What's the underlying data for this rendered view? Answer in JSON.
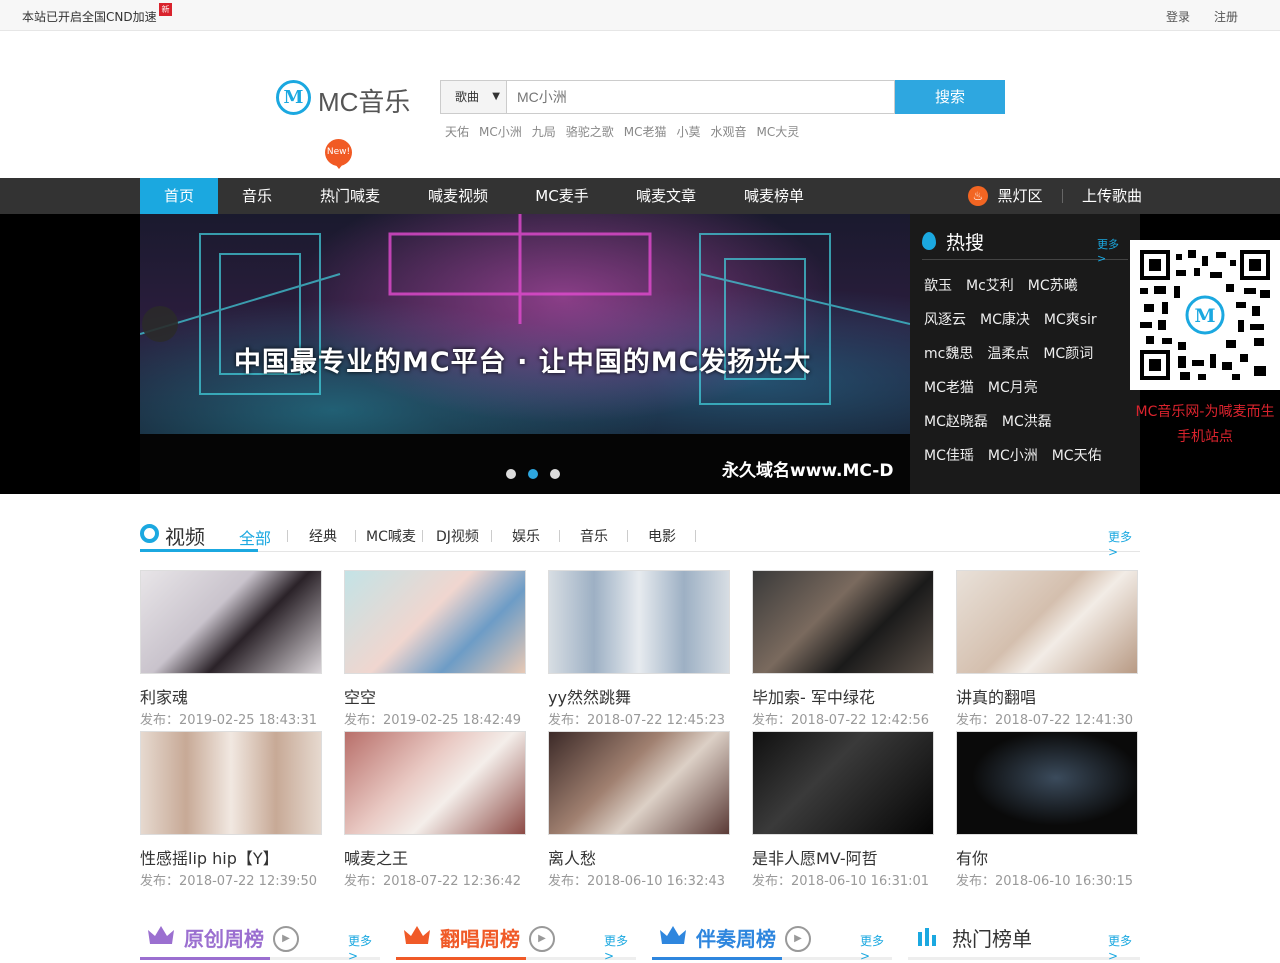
{
  "topbar": {
    "notice": "本站已开启全国CND加速",
    "new_tag": "新",
    "login": "登录",
    "register": "注册"
  },
  "logo": {
    "letter": "M",
    "text": "MC音乐"
  },
  "search": {
    "type": "歌曲",
    "placeholder": "MC小洲",
    "button": "搜索",
    "hotwords": [
      "天佑",
      "MC小洲",
      "九局",
      "骆驼之歌",
      "MC老猫",
      "小莫",
      "水观音",
      "MC大灵"
    ]
  },
  "new_badge": "New!",
  "nav": {
    "items": [
      "首页",
      "音乐",
      "热门喊麦",
      "喊麦视频",
      "MC麦手",
      "喊麦文章",
      "喊麦榜单"
    ],
    "blacklight": "黑灯区",
    "upload": "上传歌曲"
  },
  "banner": {
    "slogan": "中国最专业的MC平台 · 让中国的MC发扬光大",
    "domain": "永久域名www.MC-D"
  },
  "hotsearch": {
    "title": "热搜",
    "more": "更多>",
    "tags": [
      [
        "歆玉",
        "Mc艾利",
        "MC苏曦"
      ],
      [
        "风逐云",
        "MC康决",
        "MC爽sir"
      ],
      [
        "mc魏思",
        "温柔点",
        "MC颜词"
      ],
      [
        "MC老猫",
        "MC月亮"
      ],
      [
        "MC赵晓磊",
        "MC洪磊"
      ],
      [
        "MC佳瑶",
        "MC小洲",
        "MC天佑"
      ]
    ]
  },
  "qr": {
    "caption_line1": "MC音乐网-为喊麦而生",
    "caption_line2": "手机站点"
  },
  "video": {
    "title": "视频",
    "more": "更多>",
    "categories": [
      "全部",
      "经典",
      "MC喊麦",
      "DJ视频",
      "娱乐",
      "音乐",
      "电影"
    ],
    "items": [
      {
        "name": "利家魂",
        "date": "发布：2019-02-25 18:43:31"
      },
      {
        "name": "空空",
        "date": "发布：2019-02-25 18:42:49"
      },
      {
        "name": "yy然然跳舞",
        "date": "发布：2018-07-22 12:45:23"
      },
      {
        "name": "毕加索- 军中绿花",
        "date": "发布：2018-07-22 12:42:56"
      },
      {
        "name": "讲真的翻唱",
        "date": "发布：2018-07-22 12:41:30"
      },
      {
        "name": "性感摇lip hip【Y】",
        "date": "发布：2018-07-22 12:39:50"
      },
      {
        "name": "喊麦之王",
        "date": "发布：2018-07-22 12:36:42"
      },
      {
        "name": "离人愁",
        "date": "发布：2018-06-10 16:32:43"
      },
      {
        "name": "是非人愿MV-阿哲",
        "date": "发布：2018-06-10 16:31:01"
      },
      {
        "name": "有你",
        "date": "发布：2018-06-10 16:30:15"
      }
    ]
  },
  "charts": [
    {
      "title": "原创周榜",
      "more": "更多>",
      "color": "#9b6fd0"
    },
    {
      "title": "翻唱周榜",
      "more": "更多>",
      "color": "#f05a28"
    },
    {
      "title": "伴奏周榜",
      "more": "更多>",
      "color": "#2e86de"
    },
    {
      "title": "热门榜单",
      "more": "更多>",
      "color": "#333333"
    }
  ]
}
